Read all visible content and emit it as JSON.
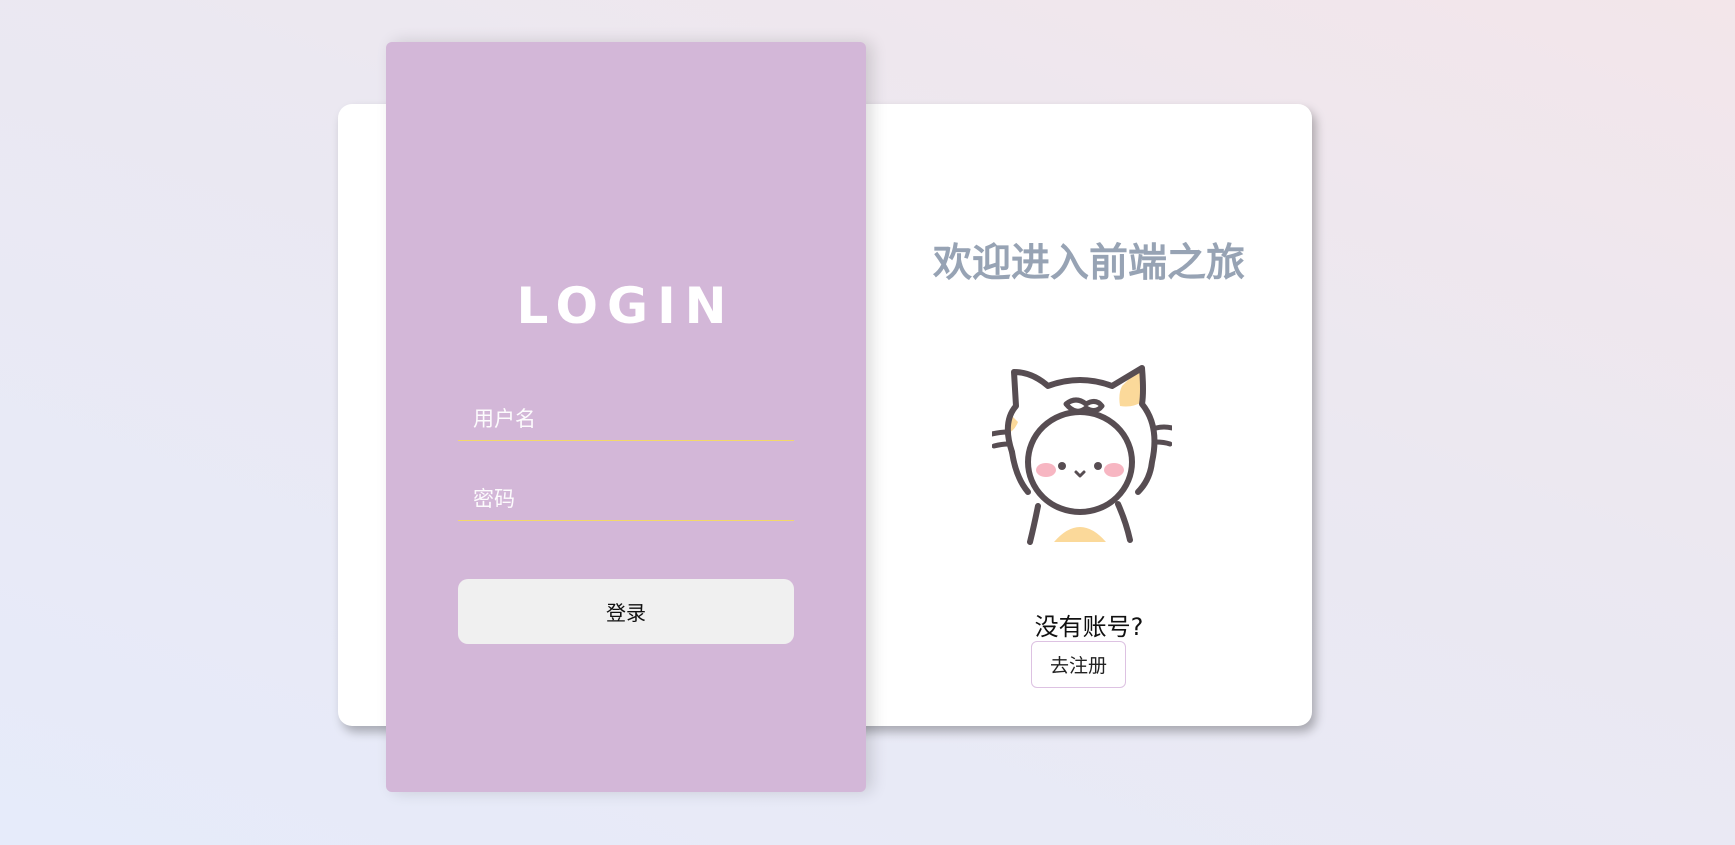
{
  "login": {
    "title": "LOGIN",
    "username_placeholder": "用户名",
    "password_placeholder": "密码",
    "submit_label": "登录"
  },
  "welcome": {
    "heading": "欢迎进入前端之旅",
    "illustration_icon": "cat-costume-mascot-icon",
    "no_account_text": "没有账号?",
    "register_label": "去注册"
  },
  "colors": {
    "login_panel": "#d3b7d8",
    "heading_text": "#97a3b4",
    "input_underline": "#f3d86a",
    "button_bg": "#f0f0f0"
  }
}
